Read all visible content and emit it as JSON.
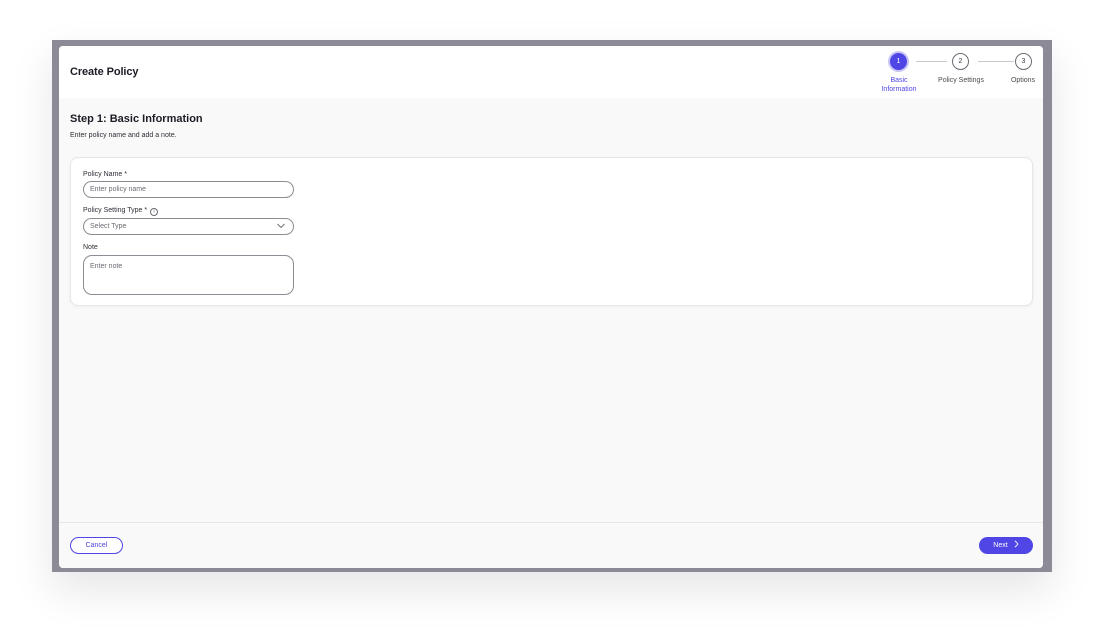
{
  "dialog": {
    "title": "Create Policy"
  },
  "stepper": {
    "steps": [
      {
        "number": "1",
        "label_line1": "Basic",
        "label_line2": "Information",
        "active": true
      },
      {
        "number": "2",
        "label": "Policy Settings",
        "active": false
      },
      {
        "number": "3",
        "label": "Options",
        "active": false
      }
    ]
  },
  "step": {
    "heading": "Step 1: Basic Information",
    "subtitle": "Enter policy name and add a note."
  },
  "form": {
    "policy_name": {
      "label": "Policy Name *",
      "placeholder": "Enter policy name"
    },
    "policy_setting_type": {
      "label": "Policy Setting Type *",
      "value": "Select Type",
      "info_icon": "info-icon"
    },
    "note": {
      "label": "Note",
      "placeholder": "Enter note"
    }
  },
  "footer": {
    "cancel_label": "Cancel",
    "next_label": "Next"
  },
  "colors": {
    "accent": "#4f46e5",
    "backdrop": "#8b8a96",
    "surface": "#f9f9fa"
  }
}
